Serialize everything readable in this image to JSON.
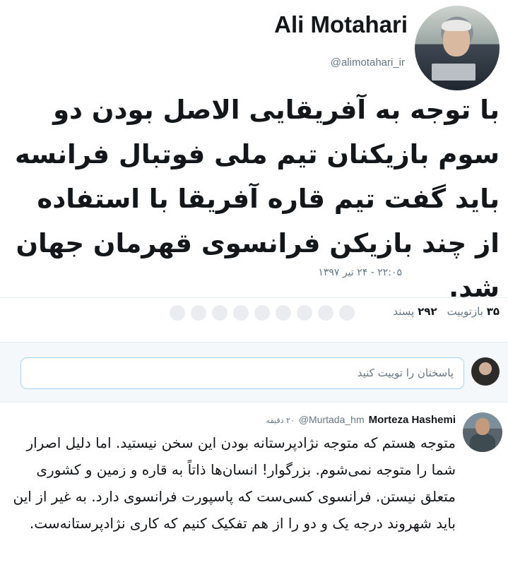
{
  "tweet": {
    "author_name": "Ali Motahari",
    "author_handle": "@alimotahari_ir",
    "text": "با توجه به آفریقایی الاصل بودن دو سوم بازیکنان تیم ملی فوتبال فرانسه باید گفت تیم قاره آفریقا با استفاده از چند بازیکن فرانسوی قهرمان جهان شد.",
    "timestamp": "۲۲:۰۵ - ۲۴ تیر ۱۳۹۷",
    "retweets_count": "۳۵",
    "retweets_label": "بازتوییت",
    "likes_count": "۲۹۲",
    "likes_label": "پسند"
  },
  "composer": {
    "placeholder": "پاسختان را توییت کنید"
  },
  "reply": {
    "author_name": "Morteza Hashemi",
    "author_handle": "@Murtada_hm",
    "time": "۲۰ دقیقه",
    "text": "متوجه هستم که متوجه نژادپرستانه بودن این سخن نیستید. اما دلیل اصرار شما را متوجه نمی‌شوم. بزرگوار! انسان‌ها ذاتاً به قاره و زمین و کشوری متعلق نیستن. فرانسوی کسی‌ست که پاسپورت فرانسوی دارد. به غیر از این باید شهروند درجه یک و دو را از هم تفکیک کنیم که کاری نژادپرستانه‌ست."
  }
}
